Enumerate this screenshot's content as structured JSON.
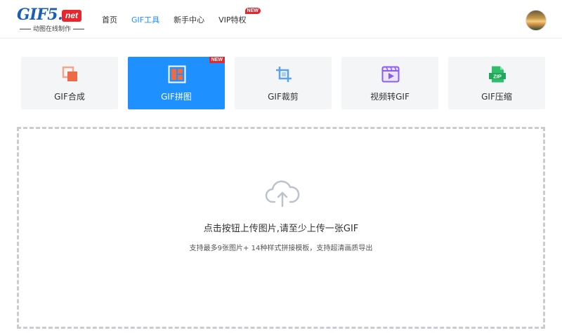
{
  "header": {
    "logo_text": "GIF5.",
    "logo_badge": "net",
    "logo_sub": "动图在线制作",
    "nav": [
      {
        "label": "首页"
      },
      {
        "label": "GIF工具"
      },
      {
        "label": "新手中心"
      },
      {
        "label": "VIP特权",
        "badge": "NEW"
      }
    ],
    "active_nav": "GIF工具"
  },
  "tools": [
    {
      "label": "GIF合成",
      "icon": "merge-icon"
    },
    {
      "label": "GIF拼图",
      "icon": "collage-icon",
      "badge": "NEW",
      "active": true
    },
    {
      "label": "GIF裁剪",
      "icon": "crop-icon"
    },
    {
      "label": "视频转GIF",
      "icon": "video-icon"
    },
    {
      "label": "GIF压缩",
      "icon": "zip-icon",
      "icon_text": "ZIP"
    }
  ],
  "upload": {
    "icon": "cloud-upload-icon",
    "title": "点击按钮上传图片,请至少上传一张GIF",
    "subtitle": "支持最多9张图片+ 14种样式拼接模板，支持超清画质导出"
  },
  "colors": {
    "accent": "#1e90ff",
    "brand": "#1a5fb4",
    "badge": "#e8262d",
    "card_bg": "#f4f5f7"
  }
}
